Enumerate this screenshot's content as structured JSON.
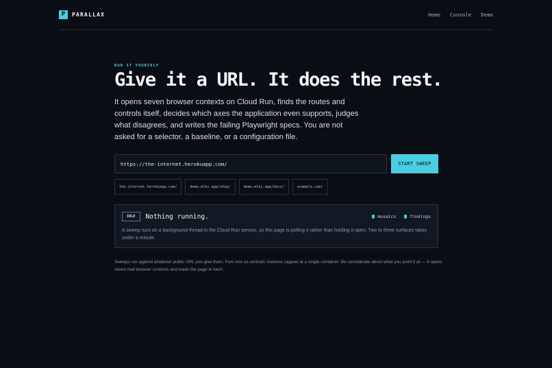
{
  "brand": {
    "mark": "P",
    "name": "PARALLAX"
  },
  "nav": [
    {
      "label": "Home"
    },
    {
      "label": "Console"
    },
    {
      "label": "Demo"
    }
  ],
  "hero": {
    "eyebrow": "RUN IT YOURSELF",
    "headline": "Give it a URL. It does the rest.",
    "lede": "It opens seven browser contexts on Cloud Run, finds the routes and controls itself, decides which axes the application even supports, judges what disagrees, and writes the failing Playwright specs. You are not asked for a selector, a baseline, or a configuration file."
  },
  "form": {
    "url_value": "https://the-internet.herokuapp.com/",
    "submit_label": "START SWEEP"
  },
  "examples": [
    {
      "label": "the-internet.herokuapp.com/"
    },
    {
      "label": "demo.mlki.app/shop/"
    },
    {
      "label": "demo.mlki.app/docs/"
    },
    {
      "label": "example.com/"
    }
  ],
  "status": {
    "badge": "IDLE",
    "title": "Nothing running.",
    "legend": [
      {
        "label": "mosaics",
        "color": "#49cde0"
      },
      {
        "label": "findings",
        "color": "#49cde0"
      }
    ],
    "description": "A sweep runs on a background thread in the Cloud Run service, so this page is polling it rather than holding it open. Two to three surfaces takes under a minute."
  },
  "footnote": "Sweeps run against whatever public URL you give them, from one us-central1 instance capped at a single container. Be considerate about what you point it at — it opens seven real browser contexts and loads the page in each.",
  "colors": {
    "accent": "#49cde0",
    "background": "#0a0e14"
  }
}
